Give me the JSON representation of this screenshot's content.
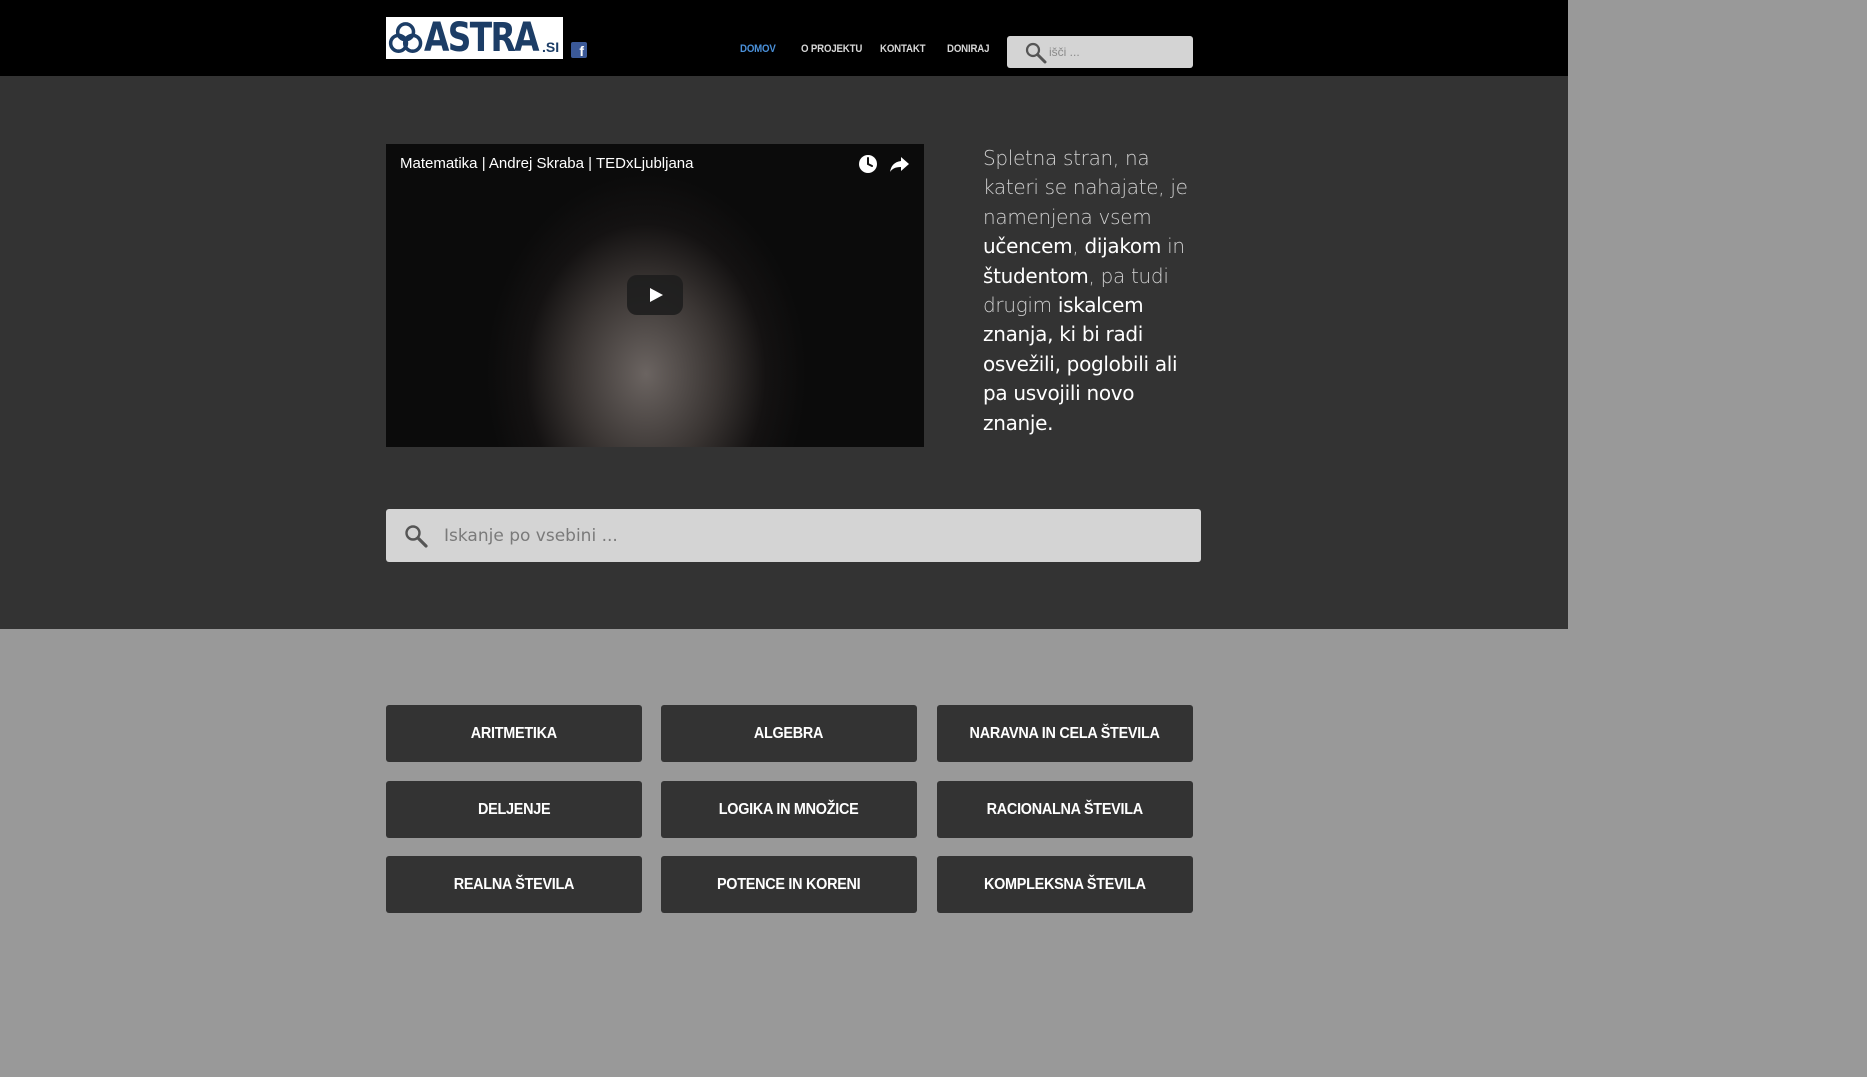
{
  "header": {
    "logo_text": "ASTRA",
    "logo_tld": ".SI",
    "facebook_glyph": "f",
    "nav": [
      {
        "label": "DOMOV",
        "active": true
      },
      {
        "label": "O PROJEKTU",
        "active": false
      },
      {
        "label": "KONTAKT",
        "active": false
      },
      {
        "label": "DONIRAJ",
        "active": false
      }
    ],
    "search_placeholder": "išči ..."
  },
  "hero": {
    "video": {
      "title": "Matematika | Andrej Skraba | TEDxLjubljana",
      "icons": [
        "clock-icon",
        "share-icon",
        "play-icon"
      ]
    },
    "intro": {
      "p1": "Spletna stran, na kateri se nahajate, je namenjena vsem ",
      "h1": "učencem",
      "p2": ", ",
      "h2": "dijakom",
      "p3": " in ",
      "h3": "študentom",
      "p4": ", pa tudi drugim ",
      "h4": "iskalcem znanja, ki bi radi osvežili, poglobili ali pa usvojili novo znanje."
    },
    "search_placeholder": "Iskanje po vsebini ..."
  },
  "categories": [
    "ARITMETIKA",
    "ALGEBRA",
    "NARAVNA IN CELA ŠTEVILA",
    "DELJENJE",
    "LOGIKA IN MNOŽICE",
    "RACIONALNA ŠTEVILA",
    "REALNA ŠTEVILA",
    "POTENCE IN KORENI",
    "KOMPLEKSNA ŠTEVILA"
  ],
  "colors": {
    "header_bg": "#000000",
    "hero_bg": "#333333",
    "page_bg": "#999999",
    "nav_active": "#4a90d9",
    "logo_blue": "#1c3d66"
  }
}
